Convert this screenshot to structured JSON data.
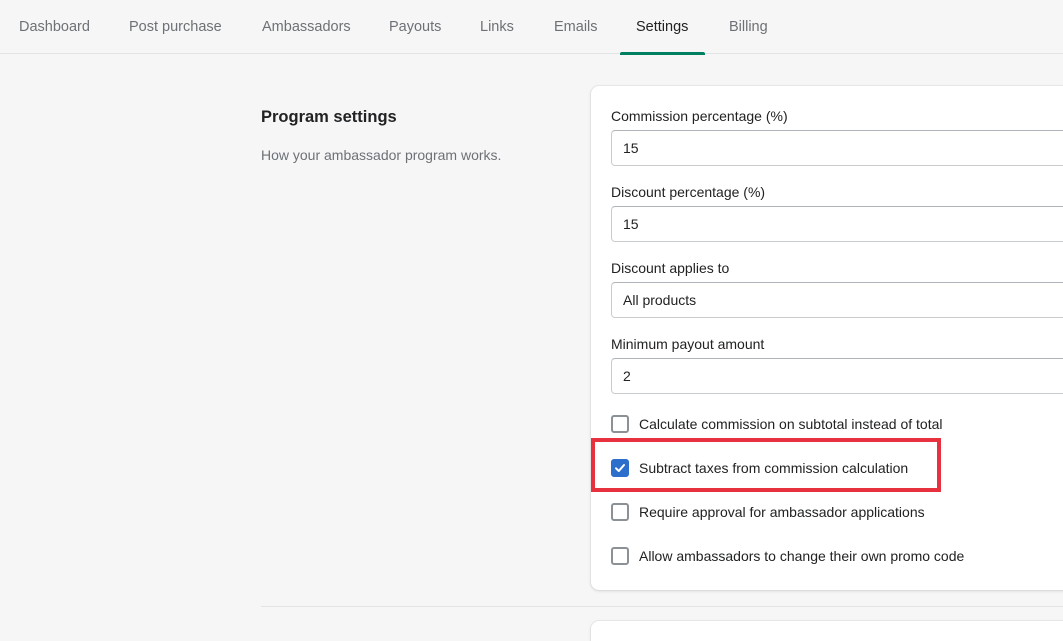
{
  "nav": {
    "tabs": [
      {
        "label": "Dashboard"
      },
      {
        "label": "Post purchase"
      },
      {
        "label": "Ambassadors"
      },
      {
        "label": "Payouts"
      },
      {
        "label": "Links"
      },
      {
        "label": "Emails"
      },
      {
        "label": "Settings"
      },
      {
        "label": "Billing"
      }
    ],
    "active": "Settings"
  },
  "section": {
    "title": "Program settings",
    "description": "How your ambassador program works."
  },
  "form": {
    "commission": {
      "label": "Commission percentage (%)",
      "value": "15"
    },
    "discount": {
      "label": "Discount percentage (%)",
      "value": "15"
    },
    "applies_to": {
      "label": "Discount applies to",
      "value": "All products"
    },
    "min_payout": {
      "label": "Minimum payout amount",
      "value": "2"
    },
    "checkboxes": [
      {
        "label": "Calculate commission on subtotal instead of total",
        "checked": false
      },
      {
        "label": "Subtract taxes from commission calculation",
        "checked": true
      },
      {
        "label": "Require approval for ambassador applications",
        "checked": false
      },
      {
        "label": "Allow ambassadors to change their own promo code",
        "checked": false
      }
    ]
  },
  "colors": {
    "accent": "#008060",
    "checkbox_checked": "#2c6ecb",
    "highlight": "#e8313f"
  }
}
